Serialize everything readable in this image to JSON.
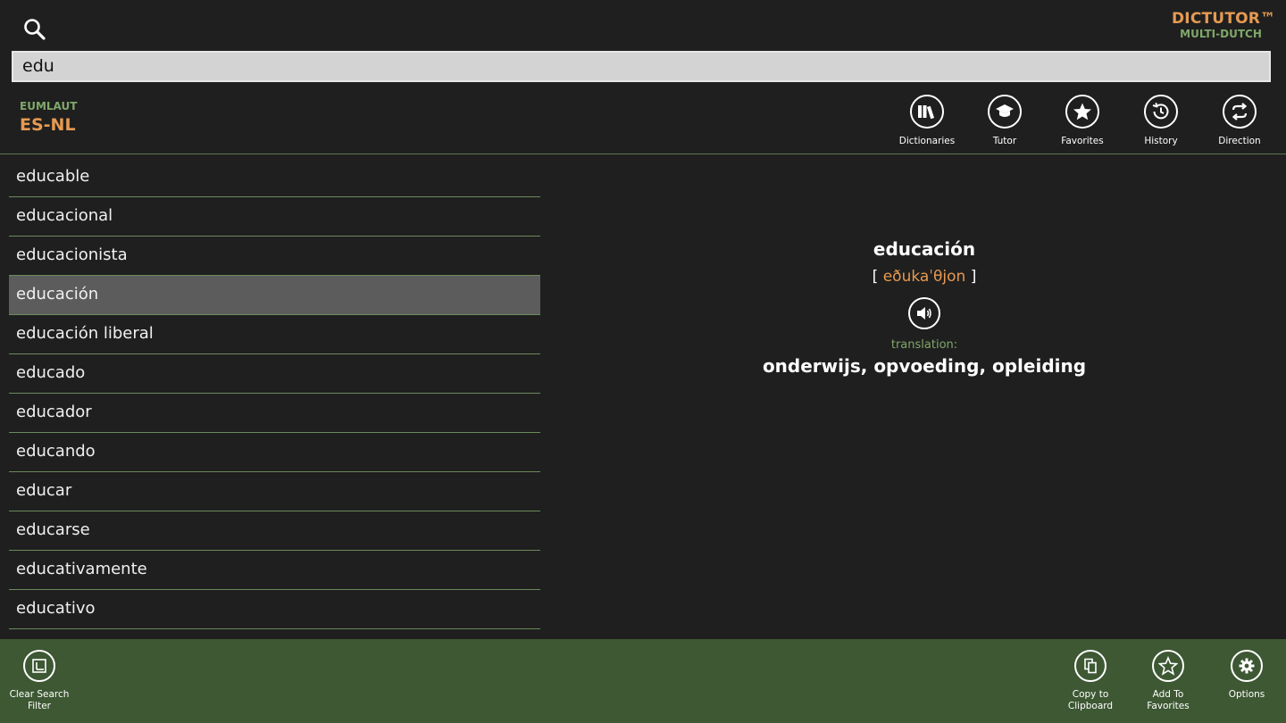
{
  "brand": {
    "name": "DICTUTOR™",
    "subtitle": "MULTI-DUTCH"
  },
  "search": {
    "value": "edu"
  },
  "dictionary": {
    "name": "EUMLAUT",
    "pair": "ES-NL"
  },
  "toolbar": {
    "dictionaries": "Dictionaries",
    "tutor": "Tutor",
    "favorites": "Favorites",
    "history": "History",
    "direction": "Direction"
  },
  "word_list": [
    "educable",
    "educacional",
    "educacionista",
    "educación",
    "educación liberal",
    "educado",
    "educador",
    "educando",
    "educar",
    "educarse",
    "educativamente",
    "educativo"
  ],
  "selected_word": "educación",
  "detail": {
    "headword": "educación",
    "bracket_open": "[",
    "ipa": "eðukaˈθjon",
    "bracket_close": "]",
    "translation_label": "translation:",
    "translation": "onderwijs, opvoeding, opleiding"
  },
  "appbar": {
    "clear_filter": "Clear Search Filter",
    "copy": "Copy to Clipboard",
    "add_favorites": "Add To Favorites",
    "options": "Options"
  },
  "colors": {
    "accent_orange": "#e59a52",
    "accent_green": "#7fa86a",
    "appbar_bg": "#3d5833",
    "selected_row": "#5c5c5c"
  }
}
